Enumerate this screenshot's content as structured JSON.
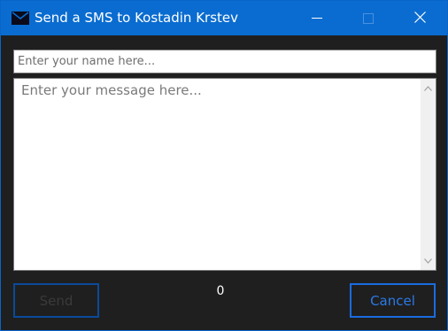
{
  "window": {
    "title": "Send a SMS to Kostadin Krstev",
    "app_icon": "envelope-icon",
    "controls": {
      "minimize_icon": "minimize-icon",
      "maximize_icon": "maximize-icon",
      "close_icon": "close-icon"
    }
  },
  "form": {
    "name_placeholder": "Enter your name here...",
    "name_value": "",
    "message_placeholder": "Enter your message here...",
    "message_value": ""
  },
  "footer": {
    "send_label": "Send",
    "character_count": "0",
    "cancel_label": "Cancel"
  },
  "colors": {
    "titlebar": "#0a6cd0",
    "window_background": "#1f1f1f",
    "send_border": "#0a4a9a",
    "cancel_border": "#1a6ce0",
    "cancel_text": "#2a7ae8"
  }
}
